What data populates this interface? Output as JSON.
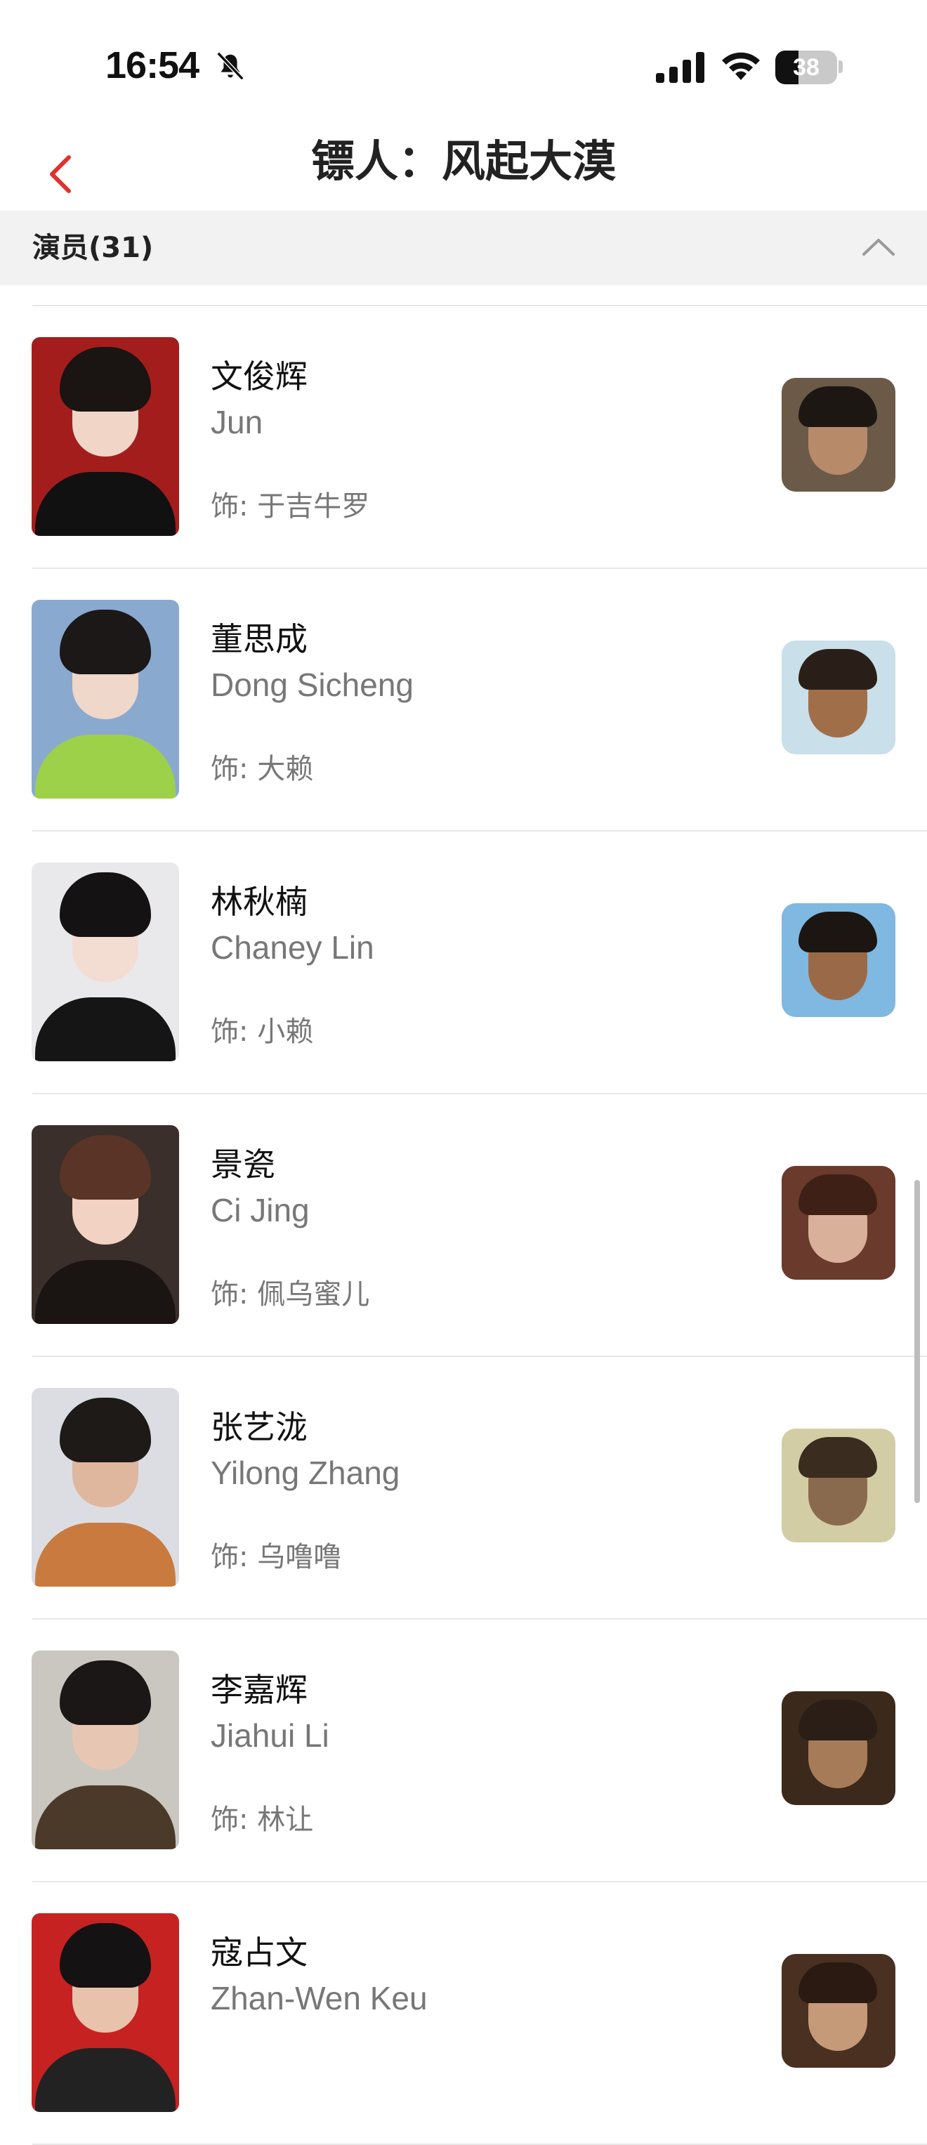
{
  "status_bar": {
    "time": "16:54",
    "battery": "38",
    "battery_level_percent": 38
  },
  "nav": {
    "title": "镖人：风起大漠",
    "accent_color": "#e0322d"
  },
  "section": {
    "title": "演员(31)"
  },
  "cast": [
    {
      "name": "文俊辉",
      "english_name": "Jun",
      "role": "饰: 于吉牛罗",
      "photo_bg": "#a31d1d",
      "hair": "#1a1412",
      "skin": "#f1d6c8",
      "body": "#111111",
      "still_bg": "#6b5a48",
      "still_hair": "#1d1714",
      "still_skin": "#b78a6a"
    },
    {
      "name": "董思成",
      "english_name": "Dong Sicheng",
      "role": "饰: 大赖",
      "photo_bg": "#8aa9cf",
      "hair": "#1c1818",
      "skin": "#efd7c9",
      "body": "#9ed14a",
      "still_bg": "#c9dfe9",
      "still_hair": "#2a1f18",
      "still_skin": "#a06f4a"
    },
    {
      "name": "林秋楠",
      "english_name": "Chaney Lin",
      "role": "饰: 小赖",
      "photo_bg": "#e9e9ec",
      "hair": "#141212",
      "skin": "#f3dcd2",
      "body": "#151515",
      "still_bg": "#7fb8e0",
      "still_hair": "#1c1612",
      "still_skin": "#9a6a48"
    },
    {
      "name": "景瓷",
      "english_name": "Ci Jing",
      "role": "饰: 佩乌蜜儿",
      "photo_bg": "#3a2f2a",
      "hair": "#5a3426",
      "skin": "#f2d2c2",
      "body": "#1a1412",
      "still_bg": "#6a3a2c",
      "still_hair": "#3f2016",
      "still_skin": "#d9b09a"
    },
    {
      "name": "张艺泷",
      "english_name": "Yilong Zhang",
      "role": "饰: 乌噜噜",
      "photo_bg": "#dcdde2",
      "hair": "#1e1a18",
      "skin": "#dfb79e",
      "body": "#c97b3f",
      "still_bg": "#d3cda6",
      "still_hair": "#3a2c1e",
      "still_skin": "#8a6a4e"
    },
    {
      "name": "李嘉辉",
      "english_name": "Jiahui Li",
      "role": "饰: 林让",
      "photo_bg": "#c9c7bf",
      "hair": "#1b1716",
      "skin": "#e7c7b4",
      "body": "#4b3a2a",
      "still_bg": "#3b2a1c",
      "still_hair": "#2a1e16",
      "still_skin": "#a67b58"
    },
    {
      "name": "寇占文",
      "english_name": "Zhan-Wen Keu",
      "role": "",
      "photo_bg": "#c62222",
      "hair": "#141212",
      "skin": "#e8c2aa",
      "body": "#222222",
      "still_bg": "#4a3020",
      "still_hair": "#2a1a12",
      "still_skin": "#c49a78"
    }
  ],
  "icons": {
    "back": "chevron-left-icon",
    "collapse": "chevron-up-icon",
    "mute": "bell-slash-icon",
    "signal": "cellular-signal-icon",
    "wifi": "wifi-icon",
    "battery": "battery-icon"
  }
}
